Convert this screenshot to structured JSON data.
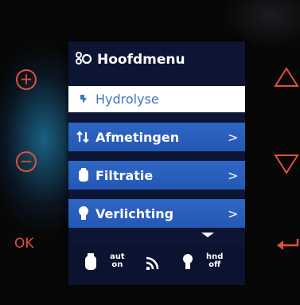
{
  "colors": {
    "accent": "#e0503c",
    "menu_bg": "#2f65c4",
    "screen_bg": "#0c1534",
    "selected_text": "#3d74c8"
  },
  "keys": {
    "plus_icon": "plus-circle-icon",
    "minus_icon": "minus-circle-icon",
    "ok_label": "OK",
    "up_icon": "triangle-up-icon",
    "down_icon": "triangle-down-icon",
    "back_icon": "back-arrow-icon"
  },
  "menu": {
    "title": "Hoofdmenu",
    "title_icon": "menu-icon",
    "items": [
      {
        "label": "Hydrolyse",
        "icon": "hydrolysis-icon",
        "selected": true,
        "has_submenu": false
      },
      {
        "label": "Afmetingen",
        "icon": "dimensions-icon",
        "selected": false,
        "has_submenu": true,
        "chevron": ">"
      },
      {
        "label": "Filtratie",
        "icon": "filter-icon",
        "selected": false,
        "has_submenu": true,
        "chevron": ">"
      },
      {
        "label": "Verlichting",
        "icon": "light-bulb-icon",
        "selected": false,
        "has_submenu": true,
        "chevron": ">"
      }
    ]
  },
  "status": {
    "filter_icon": "filter-status-icon",
    "filter_mode_line1": "aut",
    "filter_mode_line2": "on",
    "signal_icon": "wifi-signal-icon",
    "light_icon": "light-status-icon",
    "light_mode_line1": "hnd",
    "light_mode_line2": "off"
  }
}
